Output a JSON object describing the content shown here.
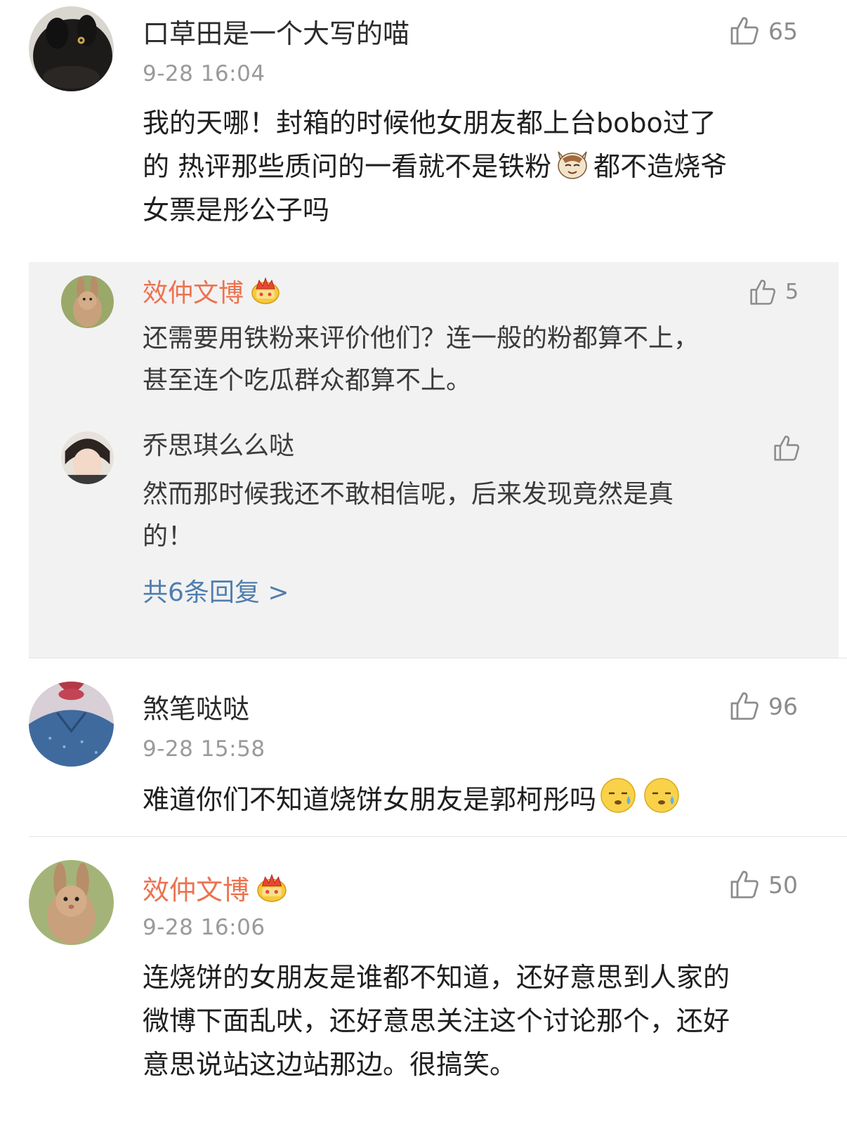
{
  "comments": [
    {
      "username": "口草田是一个大写的喵",
      "time": "9-28 16:04",
      "likes": "65",
      "text_lines": [
        "我的天哪！封箱的时候他女朋友都上台bobo过了",
        "的 热评那些质问的一看就不是铁粉",
        "都不造烧爷",
        "女票是彤公子吗"
      ],
      "replies": [
        {
          "username": "效仲文博",
          "likes": "5",
          "text_lines": [
            "还需要用铁粉来评价他们？连一般的粉都算不上，",
            "甚至连个吃瓜群众都算不上。"
          ]
        },
        {
          "username": "乔思琪么么哒",
          "text_lines": [
            "然而那时候我还不敢相信呢，后来发现竟然是真",
            "的！"
          ]
        }
      ],
      "more_replies_label": "共6条回复 >"
    },
    {
      "username": "煞笔哒哒",
      "time": "9-28 15:58",
      "likes": "96",
      "text": "难道你们不知道烧饼女朋友是郭柯彤吗"
    },
    {
      "username": "效仲文博",
      "time": "9-28 16:06",
      "likes": "50",
      "text_lines": [
        "连烧饼的女朋友是谁都不知道，还好意思到人家的",
        "微博下面乱吠，还好意思关注这个讨论那个，还好",
        "意思说站这边站那边。很搞笑。"
      ]
    }
  ],
  "icons": {
    "like": "thumbs-up-icon",
    "vip": "crown-icon",
    "cat_emoji": "cat-face-emoji",
    "sweat_emoji": "sweat-face-emoji"
  },
  "colors": {
    "vip_name": "#eb7350",
    "link": "#507daf",
    "reply_bg": "#f2f2f2",
    "meta": "#9a9a9a"
  }
}
